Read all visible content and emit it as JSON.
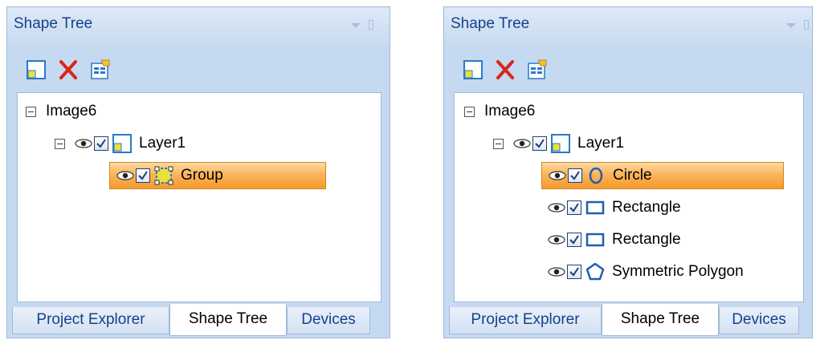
{
  "panels": [
    {
      "title": "Shape Tree",
      "toolbar": {
        "new_icon": "new-layer-icon",
        "delete_icon": "delete-icon",
        "properties_icon": "properties-icon"
      },
      "tree": {
        "root": "Image6",
        "layer": "Layer1",
        "children": [
          {
            "label": "Group",
            "icon": "group-icon",
            "selected": true
          }
        ]
      },
      "tabs": [
        "Project Explorer",
        "Shape Tree",
        "Devices"
      ],
      "active_tab": "Shape Tree"
    },
    {
      "title": "Shape Tree",
      "toolbar": {
        "new_icon": "new-layer-icon",
        "delete_icon": "delete-icon",
        "properties_icon": "properties-icon"
      },
      "tree": {
        "root": "Image6",
        "layer": "Layer1",
        "children": [
          {
            "label": "Circle",
            "icon": "circle-icon",
            "selected": true
          },
          {
            "label": "Rectangle",
            "icon": "rectangle-icon",
            "selected": false
          },
          {
            "label": "Rectangle",
            "icon": "rectangle-icon",
            "selected": false
          },
          {
            "label": "Symmetric Polygon",
            "icon": "polygon-icon",
            "selected": false
          }
        ]
      },
      "tabs": [
        "Project Explorer",
        "Shape Tree",
        "Devices"
      ],
      "active_tab": "Shape Tree"
    }
  ],
  "colors": {
    "accent": "#15428b",
    "selection": "#f59a2b",
    "panel": "#c5d9f1",
    "delete": "#d9261c"
  }
}
